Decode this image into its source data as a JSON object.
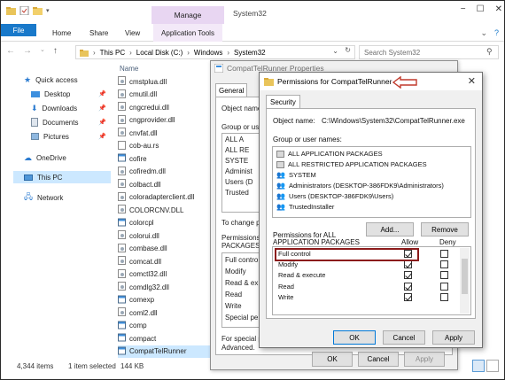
{
  "window": {
    "title": "System32",
    "manage_tab": "Manage",
    "controls": [
      "−",
      "☐",
      "✕"
    ]
  },
  "ribbon": {
    "tabs": [
      "File",
      "Home",
      "Share",
      "View",
      "Application Tools"
    ],
    "right_icons": [
      "⌄",
      "?"
    ]
  },
  "address": {
    "crumbs": [
      "This PC",
      "Local Disk (C:)",
      "Windows",
      "System32"
    ],
    "search_placeholder": "Search System32"
  },
  "nav": {
    "items": [
      {
        "label": "Quick access",
        "icon": "star-icon"
      },
      {
        "label": "Desktop",
        "icon": "desktop-icon",
        "pinned": true
      },
      {
        "label": "Downloads",
        "icon": "download-icon",
        "pinned": true
      },
      {
        "label": "Documents",
        "icon": "documents-icon",
        "pinned": true
      },
      {
        "label": "Pictures",
        "icon": "pictures-icon",
        "pinned": true
      },
      {
        "label": "OneDrive",
        "icon": "cloud-icon"
      },
      {
        "label": "This PC",
        "icon": "computer-icon",
        "selected": true
      },
      {
        "label": "Network",
        "icon": "network-icon"
      }
    ]
  },
  "files": {
    "column_header": "Name",
    "items": [
      "cmstplua.dll",
      "cmutil.dll",
      "cngcredui.dll",
      "cngprovider.dll",
      "cnvfat.dll",
      "cob-au.rs",
      "cofire",
      "cofiredm.dll",
      "colbact.dll",
      "coloradapterclient.dll",
      "COLORCNV.DLL",
      "colorcpl",
      "colorui.dll",
      "combase.dll",
      "comcat.dll",
      "comctl32.dll",
      "comdlg32.dll",
      "comexp",
      "coml2.dll",
      "comp",
      "compact",
      "CompatTelRunner"
    ],
    "selected": "CompatTelRunner"
  },
  "status": {
    "items_count": "4,344 items",
    "selection": "1 item selected",
    "size": "144 KB"
  },
  "properties_dialog": {
    "title": "CompatTelRunner Properties",
    "tab": "General",
    "object_name_label": "Object name",
    "group_label": "Group or user",
    "groups_truncated": [
      "ALL A",
      "ALL RE",
      "SYSTE",
      "Administ",
      "Users (D",
      "Trusted"
    ],
    "change_label": "To change p",
    "permissions_label": "Permissions fo",
    "packages_label": "PACKAGES",
    "perm_rows": [
      "Full contro",
      "Modify",
      "Read & ex",
      "Read",
      "Write",
      "Special pe"
    ],
    "special_label": "For special p",
    "advanced_label": "Advanced.",
    "ok": "OK",
    "cancel": "Cancel",
    "apply": "Apply"
  },
  "permissions_dialog": {
    "title": "Permissions for CompatTelRunner",
    "tab": "Security",
    "object_name_label": "Object name:",
    "object_name_value": "C:\\Windows\\System32\\CompatTelRunner.exe",
    "groups_label": "Group or user names:",
    "groups": [
      "ALL APPLICATION PACKAGES",
      "ALL RESTRICTED APPLICATION PACKAGES",
      "SYSTEM",
      "Administrators (DESKTOP-386FDK9\\Administrators)",
      "Users (DESKTOP-386FDK9\\Users)",
      "TrustedInstaller"
    ],
    "add": "Add...",
    "remove": "Remove",
    "permissions_for_line1": "Permissions for ALL",
    "permissions_for_line2": "APPLICATION PACKAGES",
    "allow_header": "Allow",
    "deny_header": "Deny",
    "rows": [
      {
        "name": "Full control",
        "allow": true,
        "deny": false
      },
      {
        "name": "Modify",
        "allow": true,
        "deny": false
      },
      {
        "name": "Read & execute",
        "allow": true,
        "deny": false
      },
      {
        "name": "Read",
        "allow": true,
        "deny": false
      },
      {
        "name": "Write",
        "allow": true,
        "deny": false
      }
    ],
    "ok": "OK",
    "cancel": "Cancel",
    "apply": "Apply"
  },
  "colors": {
    "file_tab": "#1979ca",
    "manage_tab": "#e8d6f2",
    "selection": "#cce8ff",
    "highlight_box": "#8b1a1a",
    "arrow": "#c0392b"
  }
}
